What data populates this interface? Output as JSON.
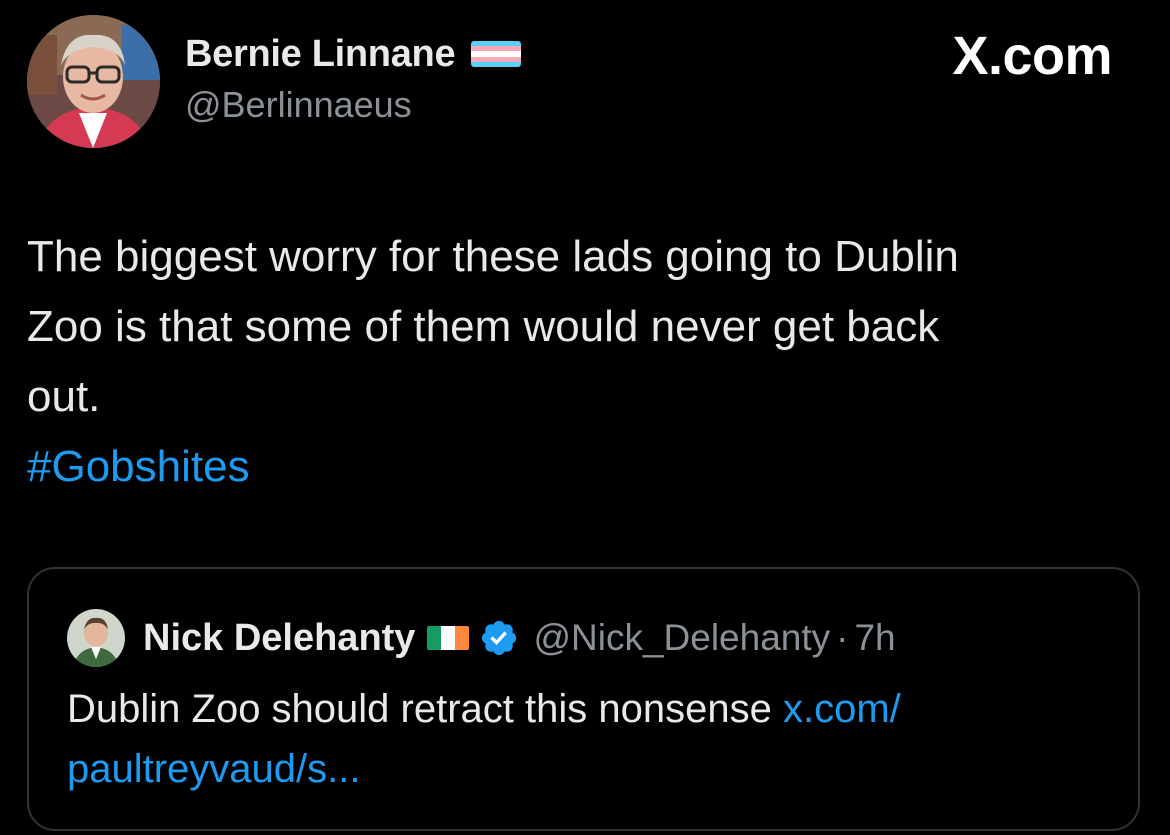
{
  "brand": "X.com",
  "author": {
    "name": "Bernie Linnane",
    "handle": "@Berlinnaeus",
    "flag_icon": "transgender-flag-icon"
  },
  "tweet": {
    "text_lines": [
      "The biggest worry for these lads going to Dublin",
      "Zoo is that some of them would never get back",
      "out."
    ],
    "hashtag": "#Gobshites"
  },
  "quote": {
    "name": "Nick Delehanty",
    "flag_icon": "ireland-flag-icon",
    "verified_icon": "verified-badge-icon",
    "handle": "@Nick_Delehanty",
    "separator": "·",
    "time": "7h",
    "text": "Dublin Zoo should retract this nonsense ",
    "link_line1": "x.com/",
    "link_line2": "paultreyvaud/s..."
  },
  "colors": {
    "background": "#000000",
    "text": "#e7e9ea",
    "secondary_text": "#8b9197",
    "link": "#1d9bf0",
    "border": "#2f3336",
    "trans_flag_blue": "#5bcefa",
    "trans_flag_pink": "#f5a9b8",
    "trans_flag_white": "#ffffff",
    "ireland_green": "#169b62",
    "ireland_white": "#ffffff",
    "ireland_orange": "#ff883e"
  }
}
